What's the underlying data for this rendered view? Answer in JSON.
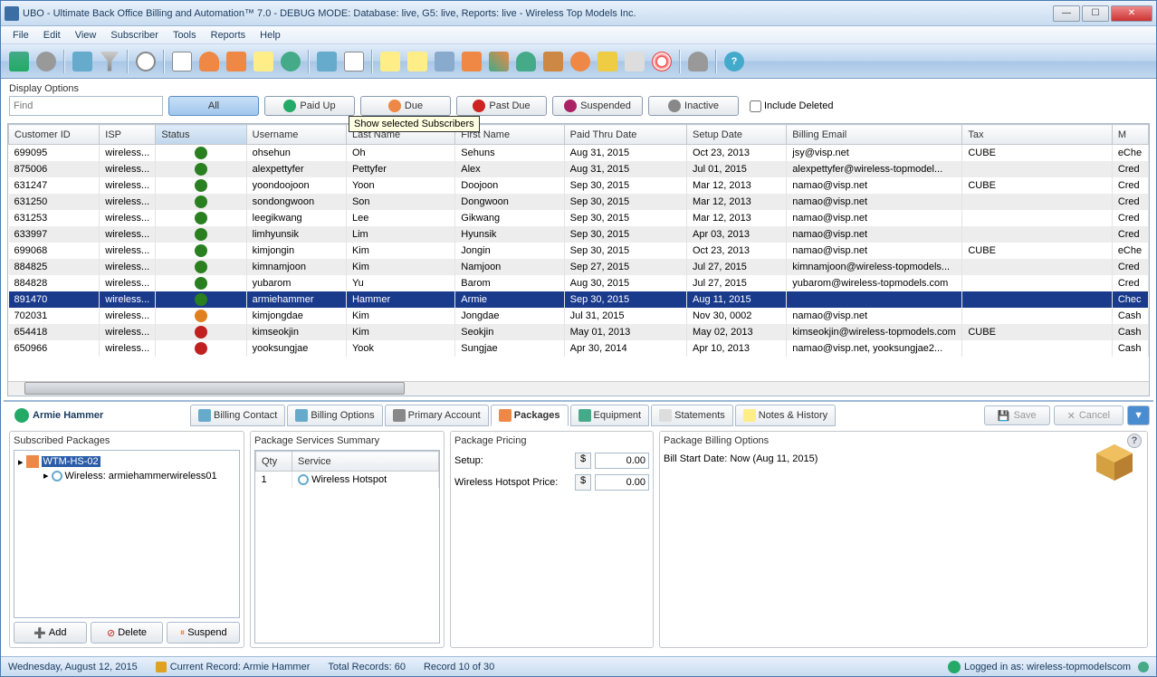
{
  "title": "UBO - Ultimate Back Office Billing and Automation™ 7.0 - DEBUG MODE: Database: live, G5: live, Reports: live - Wireless Top Models Inc.",
  "menu": [
    "File",
    "Edit",
    "View",
    "Subscriber",
    "Tools",
    "Reports",
    "Help"
  ],
  "display_options_label": "Display Options",
  "find_placeholder": "Find",
  "filters": {
    "all": "All",
    "paid_up": "Paid Up",
    "due": "Due",
    "past_due": "Past Due",
    "suspended": "Suspended",
    "inactive": "Inactive"
  },
  "include_deleted": "Include Deleted",
  "tooltip": "Show selected Subscribers",
  "columns": [
    "Customer ID",
    "ISP",
    "Status",
    "Username",
    "Last Name",
    "First Name",
    "Paid Thru Date",
    "Setup Date",
    "Billing Email",
    "Tax",
    "M"
  ],
  "rows": [
    {
      "id": "699095",
      "isp": "wireless...",
      "status": "green",
      "user": "ohsehun",
      "last": "Oh",
      "first": "Sehuns",
      "paid": "Aug 31, 2015",
      "setup": "Oct 23, 2013",
      "email": "jsy@visp.net",
      "tax": "CUBE",
      "m": "eChe"
    },
    {
      "id": "875006",
      "isp": "wireless...",
      "status": "green",
      "user": "alexpettyfer",
      "last": "Pettyfer",
      "first": "Alex",
      "paid": "Aug 31, 2015",
      "setup": "Jul 01, 2015",
      "email": "alexpettyfer@wireless-topmodel...",
      "tax": "",
      "m": "Cred"
    },
    {
      "id": "631247",
      "isp": "wireless...",
      "status": "green",
      "user": "yoondoojoon",
      "last": "Yoon",
      "first": "Doojoon",
      "paid": "Sep 30, 2015",
      "setup": "Mar 12, 2013",
      "email": "namao@visp.net",
      "tax": "CUBE",
      "m": "Cred"
    },
    {
      "id": "631250",
      "isp": "wireless...",
      "status": "green",
      "user": "sondongwoon",
      "last": "Son",
      "first": "Dongwoon",
      "paid": "Sep 30, 2015",
      "setup": "Mar 12, 2013",
      "email": "namao@visp.net",
      "tax": "",
      "m": "Cred"
    },
    {
      "id": "631253",
      "isp": "wireless...",
      "status": "green",
      "user": "leegikwang",
      "last": "Lee",
      "first": "Gikwang",
      "paid": "Sep 30, 2015",
      "setup": "Mar 12, 2013",
      "email": "namao@visp.net",
      "tax": "",
      "m": "Cred"
    },
    {
      "id": "633997",
      "isp": "wireless...",
      "status": "green",
      "user": "limhyunsik",
      "last": "Lim",
      "first": "Hyunsik",
      "paid": "Sep 30, 2015",
      "setup": "Apr 03, 2013",
      "email": "namao@visp.net",
      "tax": "",
      "m": "Cred"
    },
    {
      "id": "699068",
      "isp": "wireless...",
      "status": "green",
      "user": "kimjongin",
      "last": "Kim",
      "first": "Jongin",
      "paid": "Sep 30, 2015",
      "setup": "Oct 23, 2013",
      "email": "namao@visp.net",
      "tax": "CUBE",
      "m": "eChe"
    },
    {
      "id": "884825",
      "isp": "wireless...",
      "status": "green",
      "user": "kimnamjoon",
      "last": "Kim",
      "first": "Namjoon",
      "paid": "Sep 27, 2015",
      "setup": "Jul 27, 2015",
      "email": "kimnamjoon@wireless-topmodels...",
      "tax": "",
      "m": "Cred"
    },
    {
      "id": "884828",
      "isp": "wireless...",
      "status": "green",
      "user": "yubarom",
      "last": "Yu",
      "first": "Barom",
      "paid": "Aug 30, 2015",
      "setup": "Jul 27, 2015",
      "email": "yubarom@wireless-topmodels.com",
      "tax": "",
      "m": "Cred"
    },
    {
      "id": "891470",
      "isp": "wireless...",
      "status": "green",
      "user": "armiehammer",
      "last": "Hammer",
      "first": "Armie",
      "paid": "Sep 30, 2015",
      "setup": "Aug 11, 2015",
      "email": "",
      "tax": "",
      "m": "Chec",
      "sel": true
    },
    {
      "id": "702031",
      "isp": "wireless...",
      "status": "orange",
      "user": "kimjongdae",
      "last": "Kim",
      "first": "Jongdae",
      "paid": "Jul 31, 2015",
      "setup": "Nov 30, 0002",
      "email": "namao@visp.net",
      "tax": "",
      "m": "Cash"
    },
    {
      "id": "654418",
      "isp": "wireless...",
      "status": "red",
      "user": "kimseokjin",
      "last": "Kim",
      "first": "Seokjin",
      "paid": "May 01, 2013",
      "setup": "May 02, 2013",
      "email": "kimseokjin@wireless-topmodels.com",
      "tax": "CUBE",
      "m": "Cash"
    },
    {
      "id": "650966",
      "isp": "wireless...",
      "status": "red",
      "user": "yooksungjae",
      "last": "Yook",
      "first": "Sungjae",
      "paid": "Apr 30, 2014",
      "setup": "Apr 10, 2013",
      "email": "namao@visp.net, yooksungjae2...",
      "tax": "",
      "m": "Cash"
    }
  ],
  "customer_name": "Armie Hammer",
  "tabs": {
    "billing_contact": "Billing Contact",
    "billing_options": "Billing Options",
    "primary_account": "Primary Account",
    "packages": "Packages",
    "equipment": "Equipment",
    "statements": "Statements",
    "notes": "Notes & History"
  },
  "buttons": {
    "save": "Save",
    "cancel": "Cancel",
    "add": "Add",
    "delete": "Delete",
    "suspend": "Suspend"
  },
  "panel": {
    "subscribed": "Subscribed Packages",
    "pkg_selected": "WTM-HS-02",
    "pkg_child": "Wireless: armiehammerwireless01",
    "summary": "Package Services Summary",
    "qty_h": "Qty",
    "svc_h": "Service",
    "qty": "1",
    "svc": "Wireless Hotspot",
    "pricing": "Package Pricing",
    "setup_l": "Setup:",
    "setup_v": "0.00",
    "price_l": "Wireless Hotspot Price:",
    "price_v": "0.00",
    "cur": "$",
    "billing": "Package Billing Options",
    "bill_start": "Bill Start Date: Now (Aug 11, 2015)"
  },
  "status": {
    "date": "Wednesday, August 12, 2015",
    "record": "Current Record: Armie Hammer",
    "total": "Total Records: 60",
    "recnum": "Record 10 of 30",
    "login": "Logged in as: wireless-topmodelscom"
  }
}
